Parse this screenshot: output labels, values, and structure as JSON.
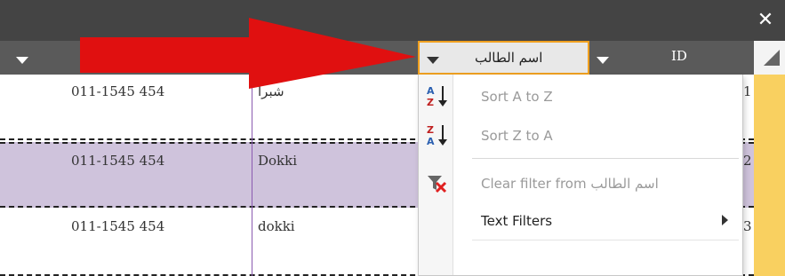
{
  "window": {
    "close_glyph": "✕"
  },
  "header": {
    "name_col": "اسم الطالب",
    "id_col": "ID"
  },
  "rows": [
    {
      "phone": "011-1545 454",
      "city": "شبرا",
      "id": "1"
    },
    {
      "phone": "011-1545 454",
      "city": "Dokki",
      "id": "2"
    },
    {
      "phone": "011-1545 454",
      "city": "dokki",
      "id": "3"
    }
  ],
  "menu": {
    "items": [
      {
        "label": "Sort A to Z",
        "accel": "S",
        "icon": "sort-a-z-icon",
        "enabled": false
      },
      {
        "label": "Sort Z to A",
        "accel": "o",
        "icon": "sort-z-a-icon",
        "enabled": false
      },
      {
        "label": "Clear filter from اسم الطالب",
        "accel": "l",
        "icon": "clear-filter-icon",
        "enabled": false
      },
      {
        "label": "Text Filters",
        "accel": "F",
        "icon": "",
        "enabled": true,
        "submenu": true
      }
    ]
  },
  "colors": {
    "title_bar": "#444444",
    "header_bg": "#5a5a5a",
    "selected_row": "#cfc3dc",
    "highlight_col": "#f9d060",
    "focus_border": "#f0a020",
    "arrow": "#e01010"
  }
}
